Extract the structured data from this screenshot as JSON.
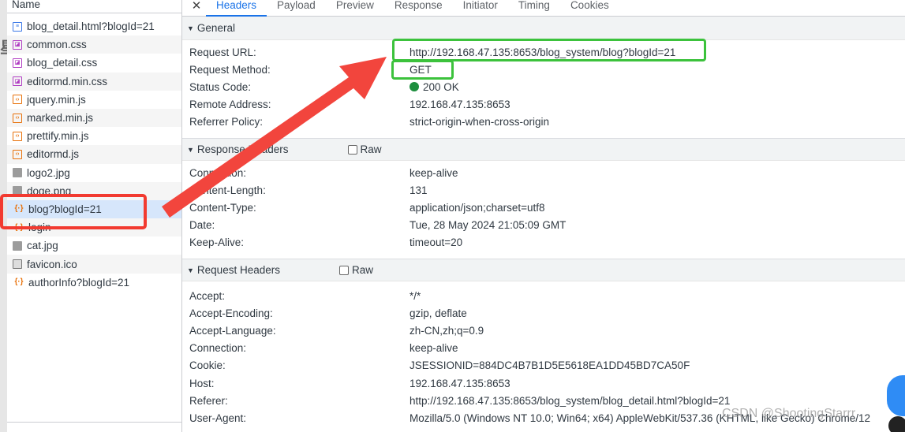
{
  "file_list": {
    "header": "Name",
    "items": [
      {
        "label": "blog_detail.html?blogId=21",
        "icon": "document-icon"
      },
      {
        "label": "common.css",
        "icon": "css-file-icon"
      },
      {
        "label": "blog_detail.css",
        "icon": "css-file-icon"
      },
      {
        "label": "editormd.min.css",
        "icon": "css-file-icon"
      },
      {
        "label": "jquery.min.js",
        "icon": "script-file-icon"
      },
      {
        "label": "marked.min.js",
        "icon": "script-file-icon"
      },
      {
        "label": "prettify.min.js",
        "icon": "script-file-icon"
      },
      {
        "label": "editormd.js",
        "icon": "script-file-icon"
      },
      {
        "label": "logo2.jpg",
        "icon": "image-file-icon"
      },
      {
        "label": "doge.png",
        "icon": "image-file-icon"
      },
      {
        "label": "blog?blogId=21",
        "icon": "fetch-request-icon",
        "selected": true
      },
      {
        "label": "login",
        "icon": "fetch-request-icon"
      },
      {
        "label": "cat.jpg",
        "icon": "image-file-icon"
      },
      {
        "label": "favicon.ico",
        "icon": "favicon-file-icon"
      },
      {
        "label": "authorInfo?blogId=21",
        "icon": "fetch-request-icon"
      }
    ]
  },
  "tabs": {
    "close": "✕",
    "items": [
      "Headers",
      "Payload",
      "Preview",
      "Response",
      "Initiator",
      "Timing",
      "Cookies"
    ],
    "active": "Headers"
  },
  "general": {
    "title": "General",
    "rows": [
      {
        "key": "Request URL:",
        "value": "http://192.168.47.135:8653/blog_system/blog?blogId=21"
      },
      {
        "key": "Request Method:",
        "value": "GET"
      },
      {
        "key": "Status Code:",
        "value": "200 OK"
      },
      {
        "key": "Remote Address:",
        "value": "192.168.47.135:8653"
      },
      {
        "key": "Referrer Policy:",
        "value": "strict-origin-when-cross-origin"
      }
    ]
  },
  "response_headers": {
    "title": "Response Headers",
    "raw_label": "Raw",
    "rows": [
      {
        "key": "Connection:",
        "value": "keep-alive"
      },
      {
        "key": "Content-Length:",
        "value": "131"
      },
      {
        "key": "Content-Type:",
        "value": "application/json;charset=utf8"
      },
      {
        "key": "Date:",
        "value": "Tue, 28 May 2024 21:05:09 GMT"
      },
      {
        "key": "Keep-Alive:",
        "value": "timeout=20"
      }
    ]
  },
  "request_headers": {
    "title": "Request Headers",
    "raw_label": "Raw",
    "rows": [
      {
        "key": "Accept:",
        "value": "*/*"
      },
      {
        "key": "Accept-Encoding:",
        "value": "gzip, deflate"
      },
      {
        "key": "Accept-Language:",
        "value": "zh-CN,zh;q=0.9"
      },
      {
        "key": "Connection:",
        "value": "keep-alive"
      },
      {
        "key": "Cookie:",
        "value": "JSESSIONID=884DC4B7B1D5E5618EA1DD45BD7CA50F"
      },
      {
        "key": "Host:",
        "value": "192.168.47.135:8653"
      },
      {
        "key": "Referer:",
        "value": "http://192.168.47.135:8653/blog_system/blog_detail.html?blogId=21"
      },
      {
        "key": "User-Agent:",
        "value": "Mozilla/5.0 (Windows NT 10.0; Win64; x64) AppleWebKit/537.36 (KHTML, like Gecko) Chrome/12"
      }
    ]
  },
  "watermark": "CSDN @ShootingStarrr",
  "colors": {
    "annotation_green": "#3cc23c",
    "annotation_red": "#f23a30",
    "selected_row": "#d6e6fb",
    "active_tab": "#1a73e8",
    "status_ok": "#1e8e3e"
  }
}
